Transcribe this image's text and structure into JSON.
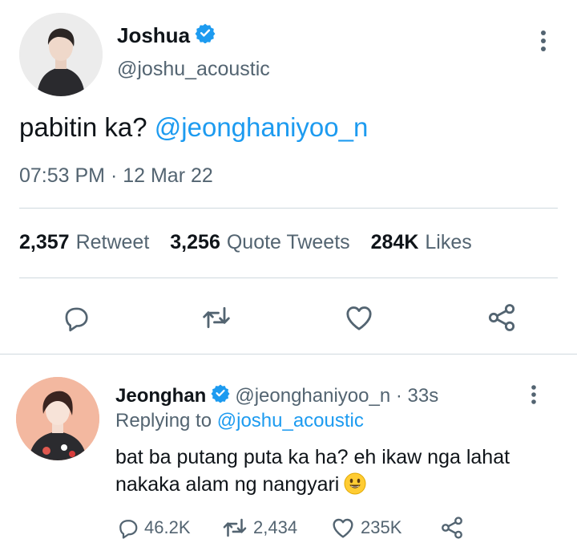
{
  "main_tweet": {
    "author_name": "Joshua",
    "author_handle": "@joshu_acoustic",
    "text": "pabitin ka?",
    "mention": "@jeonghaniyoo_n",
    "timestamp": "07:53 PM · 12 Mar 22",
    "stats": {
      "retweets_count": "2,357",
      "retweets_label": "Retweet",
      "quotes_count": "3,256",
      "quotes_label": "Quote Tweets",
      "likes_count": "284K",
      "likes_label": "Likes"
    },
    "actions": [
      "reply-icon",
      "retweet-icon",
      "like-icon",
      "share-icon"
    ]
  },
  "reply_tweet": {
    "author_name": "Jeonghan",
    "author_meta": "@jeonghaniyoo_n · 33s",
    "replying_prefix": "Replying to",
    "replying_handle": "@joshu_acoustic",
    "text": "bat ba putang puta ka ha? eh ikaw nga lahat nakaka alam ng nangyari",
    "reply_count": "46.2K",
    "retweet_count": "2,434",
    "like_count": "235K"
  },
  "colors": {
    "accent": "#1d9bf0",
    "text_primary": "#0f1419",
    "text_secondary": "#536471",
    "divider": "#cfd9de"
  }
}
